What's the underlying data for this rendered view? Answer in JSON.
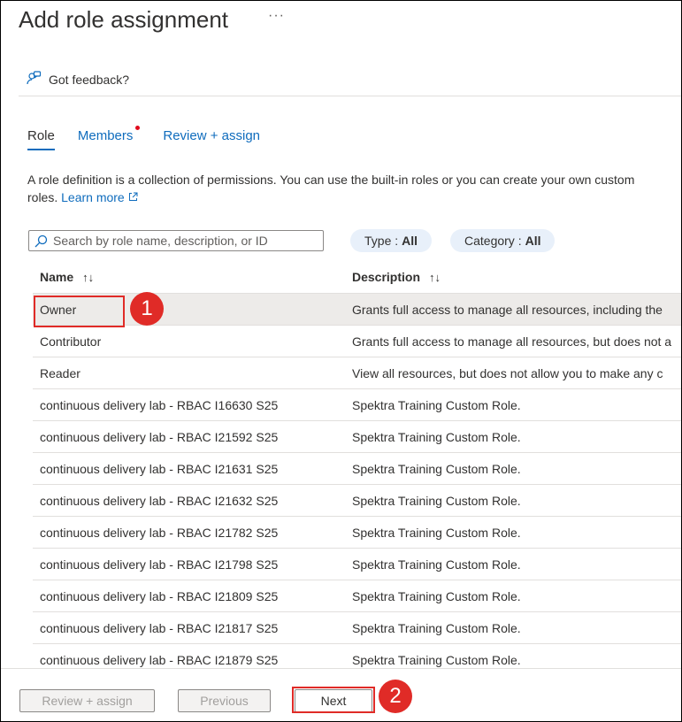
{
  "header": {
    "title": "Add role assignment",
    "more": "···"
  },
  "feedback": {
    "label": "Got feedback?",
    "icon": "feedback-person-icon"
  },
  "tabs": [
    {
      "label": "Role",
      "active": true
    },
    {
      "label": "Members",
      "has_dot": true
    },
    {
      "label": "Review + assign"
    }
  ],
  "description": {
    "text": "A role definition is a collection of permissions. You can use the built-in roles or you can create your own custom roles.",
    "link": "Learn more"
  },
  "search": {
    "placeholder": "Search by role name, description, or ID",
    "value": ""
  },
  "filters": [
    {
      "label": "Type :",
      "value": "All"
    },
    {
      "label": "Category :",
      "value": "All"
    }
  ],
  "table": {
    "columns": [
      "Name",
      "Description"
    ],
    "sort_icon": "↑↓",
    "rows": [
      {
        "name": "Owner",
        "description": "Grants full access to manage all resources, including the"
      },
      {
        "name": "Contributor",
        "description": "Grants full access to manage all resources, but does not a"
      },
      {
        "name": "Reader",
        "description": "View all resources, but does not allow you to make any c"
      },
      {
        "name": "continuous delivery lab - RBAC I16630 S25",
        "description": "Spektra Training Custom Role."
      },
      {
        "name": "continuous delivery lab - RBAC I21592 S25",
        "description": "Spektra Training Custom Role."
      },
      {
        "name": "continuous delivery lab - RBAC I21631 S25",
        "description": "Spektra Training Custom Role."
      },
      {
        "name": "continuous delivery lab - RBAC I21632 S25",
        "description": "Spektra Training Custom Role."
      },
      {
        "name": "continuous delivery lab - RBAC I21782 S25",
        "description": "Spektra Training Custom Role."
      },
      {
        "name": "continuous delivery lab - RBAC I21798 S25",
        "description": "Spektra Training Custom Role."
      },
      {
        "name": "continuous delivery lab - RBAC I21809 S25",
        "description": "Spektra Training Custom Role."
      },
      {
        "name": "continuous delivery lab - RBAC I21817 S25",
        "description": "Spektra Training Custom Role."
      },
      {
        "name": "continuous delivery lab - RBAC I21879 S25",
        "description": "Spektra Training Custom Role."
      }
    ]
  },
  "annotations": {
    "step1": "1",
    "step2": "2",
    "color": "#e02b27"
  },
  "footer": {
    "review_label": "Review + assign",
    "previous_label": "Previous",
    "next_label": "Next"
  }
}
